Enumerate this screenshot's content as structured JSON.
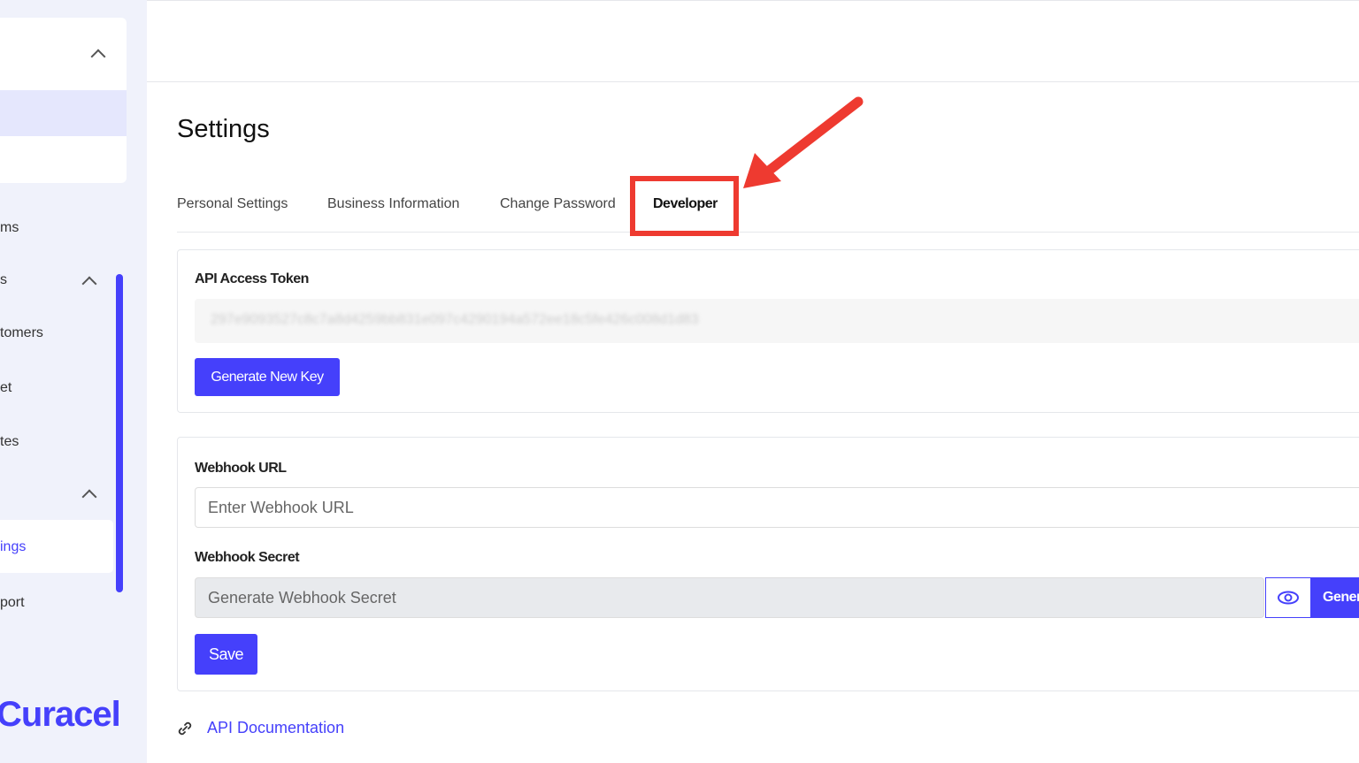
{
  "sidebar": {
    "items": [
      "ms",
      "s",
      "tomers",
      "et",
      "tes",
      "ings",
      "port"
    ],
    "logo": "Curacel"
  },
  "header": {
    "title": "Settings"
  },
  "tabs": [
    {
      "label": "Personal Settings"
    },
    {
      "label": "Business Information"
    },
    {
      "label": "Change Password"
    },
    {
      "label": "Developer",
      "active": true
    }
  ],
  "api": {
    "label": "API Access Token",
    "token": "297e9093527c8c7a8d4259bb831e097c4290194a572ee18c5fe426c008d1d83",
    "generate_label": "Generate New Key"
  },
  "webhook": {
    "url_label": "Webhook URL",
    "url_placeholder": "Enter Webhook URL",
    "secret_label": "Webhook Secret",
    "secret_placeholder": "Generate Webhook Secret",
    "generate_label": "Gener",
    "save_label": "Save"
  },
  "docs": {
    "link_label": "API Documentation"
  },
  "colors": {
    "accent": "#4540fb",
    "highlight": "#ee3a30"
  }
}
